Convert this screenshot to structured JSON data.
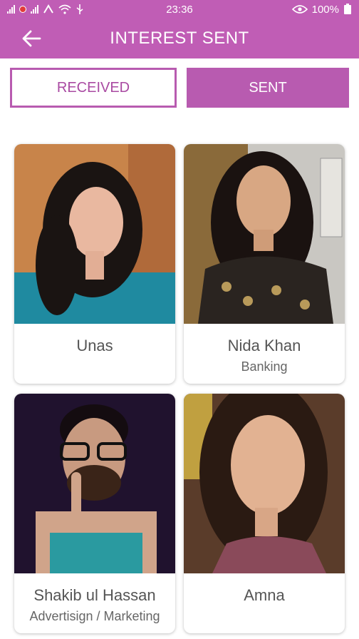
{
  "status_bar": {
    "time": "23:36",
    "battery": "100%",
    "icons": [
      "signal-icon",
      "no-sim-icon",
      "signal-icon",
      "data-icon",
      "wifi-icon",
      "usb-icon",
      "eye-icon"
    ]
  },
  "app_bar": {
    "title": "INTEREST SENT",
    "back_icon": "arrow-left-icon"
  },
  "tabs": {
    "received_label": "RECEIVED",
    "sent_label": "SENT",
    "active": "sent"
  },
  "colors": {
    "primary": "#c05db5",
    "tab_active": "#b85bb0",
    "tab_inactive_text": "#a94aa2"
  },
  "profiles": [
    {
      "name": "Unas",
      "job": ""
    },
    {
      "name": "Nida Khan",
      "job": "Banking"
    },
    {
      "name": "Shakib ul Hassan",
      "job": "Advertisign / Marketing"
    },
    {
      "name": "Amna",
      "job": ""
    }
  ]
}
